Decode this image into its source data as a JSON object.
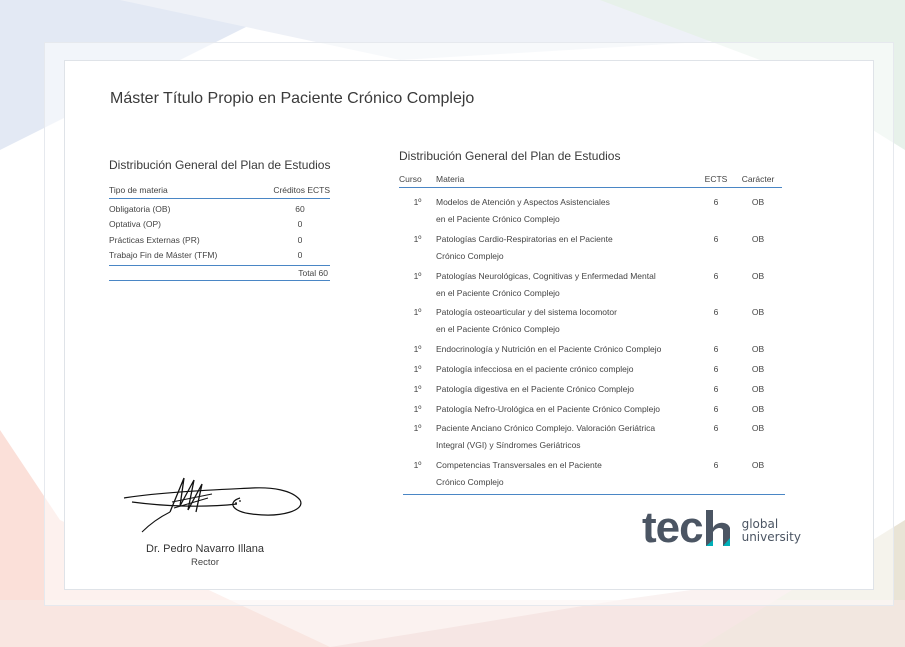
{
  "document": {
    "title": "Máster Título Propio en Paciente Crónico Complejo"
  },
  "summary": {
    "heading": "Distribución General del Plan de Estudios",
    "col_tipo": "Tipo de materia",
    "col_creditos": "Créditos ECTS",
    "rows": [
      {
        "tipo": "Obligatoria (OB)",
        "creditos": "60"
      },
      {
        "tipo": "Optativa (OP)",
        "creditos": "0"
      },
      {
        "tipo": "Prácticas Externas (PR)",
        "creditos": "0"
      },
      {
        "tipo": "Trabajo Fin de Máster (TFM)",
        "creditos": "0"
      }
    ],
    "total": "Total 60"
  },
  "plan": {
    "heading": "Distribución General del Plan de Estudios",
    "col_curso": "Curso",
    "col_materia": "Materia",
    "col_ects": "ECTS",
    "col_caracter": "Carácter",
    "rows": [
      {
        "curso": "1º",
        "materia": "Modelos de Atención y Aspectos Asistenciales\nen el Paciente Crónico Complejo",
        "ects": "6",
        "caracter": "OB"
      },
      {
        "curso": "1º",
        "materia": "Patologías Cardio-Respiratorias en el Paciente\nCrónico Complejo",
        "ects": "6",
        "caracter": "OB"
      },
      {
        "curso": "1º",
        "materia": "Patologías Neurológicas, Cognitivas y Enfermedad Mental\nen el Paciente Crónico Complejo",
        "ects": "6",
        "caracter": "OB"
      },
      {
        "curso": "1º",
        "materia": "Patología osteoarticular y del sistema locomotor\nen el Paciente Crónico Complejo",
        "ects": "6",
        "caracter": "OB"
      },
      {
        "curso": "1º",
        "materia": "Endocrinología y Nutrición en el Paciente Crónico Complejo",
        "ects": "6",
        "caracter": "OB"
      },
      {
        "curso": "1º",
        "materia": "Patología infecciosa en el paciente crónico complejo",
        "ects": "6",
        "caracter": "OB"
      },
      {
        "curso": "1º",
        "materia": "Patología digestiva en el Paciente Crónico Complejo",
        "ects": "6",
        "caracter": "OB"
      },
      {
        "curso": "1º",
        "materia": "Patología Nefro-Urológica en el Paciente Crónico Complejo",
        "ects": "6",
        "caracter": "OB"
      },
      {
        "curso": "1º",
        "materia": "Paciente Anciano Crónico Complejo. Valoración Geriátrica\nIntegral (VGI) y Síndromes Geriátricos",
        "ects": "6",
        "caracter": "OB"
      },
      {
        "curso": "1º",
        "materia": "Competencias Transversales en el Paciente\nCrónico Complejo",
        "ects": "6",
        "caracter": "OB"
      }
    ]
  },
  "signatory": {
    "name": "Dr. Pedro Navarro Illana",
    "role": "Rector"
  },
  "logo": {
    "wordmark": "tech",
    "line1": "global",
    "line2": "university"
  },
  "colors": {
    "rule_blue": "#4a86c5",
    "logo_gray": "#4b5563",
    "logo_accent": "#00b0b9"
  }
}
